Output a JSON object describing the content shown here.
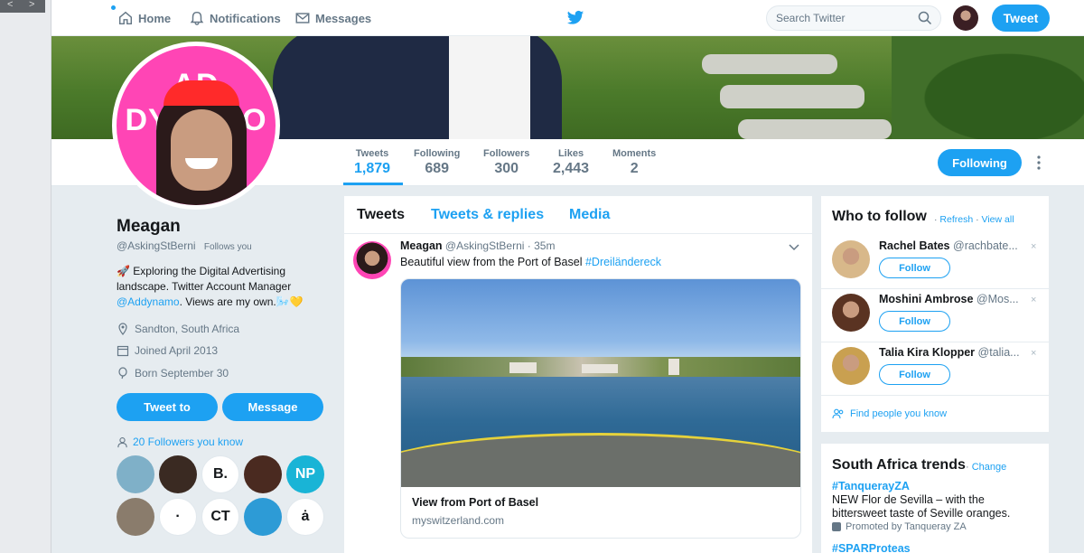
{
  "nav": {
    "home": "Home",
    "notifications": "Notifications",
    "messages": "Messages",
    "search_placeholder": "Search Twitter",
    "tweet_button": "Tweet"
  },
  "banner": {
    "avatar_text": "AD DYNAMO"
  },
  "stats": [
    {
      "label": "Tweets",
      "value": "1,879"
    },
    {
      "label": "Following",
      "value": "689"
    },
    {
      "label": "Followers",
      "value": "300"
    },
    {
      "label": "Likes",
      "value": "2,443"
    },
    {
      "label": "Moments",
      "value": "2"
    }
  ],
  "following_button": "Following",
  "profile": {
    "name": "Meagan",
    "handle": "@AskingStBerni",
    "follows_you": "Follows you",
    "bio_1": "🚀 Exploring the Digital Advertising landscape. Twitter Account Manager",
    "bio_link": "@Addynamo",
    "bio_2": ". Views are my own.🌬️💛",
    "location": "Sandton, South Africa",
    "joined": "Joined April 2013",
    "born": "Born September 30",
    "tweet_to": "Tweet to",
    "message": "Message",
    "followers_you_know": "20 Followers you know",
    "known_followers": [
      {
        "glyph": "",
        "color": "#7fb0c8"
      },
      {
        "glyph": "",
        "color": "#3a2a22"
      },
      {
        "glyph": "B.",
        "color": "#ffffff"
      },
      {
        "glyph": "",
        "color": "#4a2a20"
      },
      {
        "glyph": "NP",
        "color": "#19b4d6"
      },
      {
        "glyph": "",
        "color": "#8a7c6c"
      },
      {
        "glyph": "·",
        "color": "#ffffff"
      },
      {
        "glyph": "CT",
        "color": "#ffffff"
      },
      {
        "glyph": "",
        "color": "#2d9bd6"
      },
      {
        "glyph": "ȧ",
        "color": "#ffffff"
      }
    ]
  },
  "tabs": {
    "tweets": "Tweets",
    "replies": "Tweets & replies",
    "media": "Media"
  },
  "tweet": {
    "name": "Meagan",
    "handle": "@AskingStBerni",
    "time": "· 35m",
    "text": "Beautiful view from the Port of Basel ",
    "hashtag": "#Dreiländereck",
    "card_title": "View from Port of Basel",
    "card_url": "myswitzerland.com"
  },
  "who_to_follow": {
    "title": "Who to follow",
    "refresh": "Refresh",
    "dot": "·",
    "view_all": "View all",
    "follow_label": "Follow",
    "close": "×",
    "users": [
      {
        "name": "Rachel Bates",
        "handle": "@rachbate...",
        "color": "#d8b88a"
      },
      {
        "name": "Moshini Ambrose",
        "handle": "@Mos...",
        "color": "#5a3322"
      },
      {
        "name": "Talia Kira Klopper",
        "handle": "@talia...",
        "color": "#c9a050"
      }
    ],
    "find_people": "Find people you know"
  },
  "trends": {
    "title": "South Africa trends",
    "change": "Change",
    "dot": "·",
    "trend1": "#TanquerayZA",
    "trend1_desc": "NEW Flor de Sevilla – with the bittersweet taste of Seville oranges.",
    "trend1_promo": "Promoted by Tanqueray ZA",
    "trend2": "#SPARProteas"
  },
  "colors": {
    "accent": "#1da1f2",
    "background": "#e6ecf0",
    "text": "#14171a",
    "muted": "#657786"
  }
}
